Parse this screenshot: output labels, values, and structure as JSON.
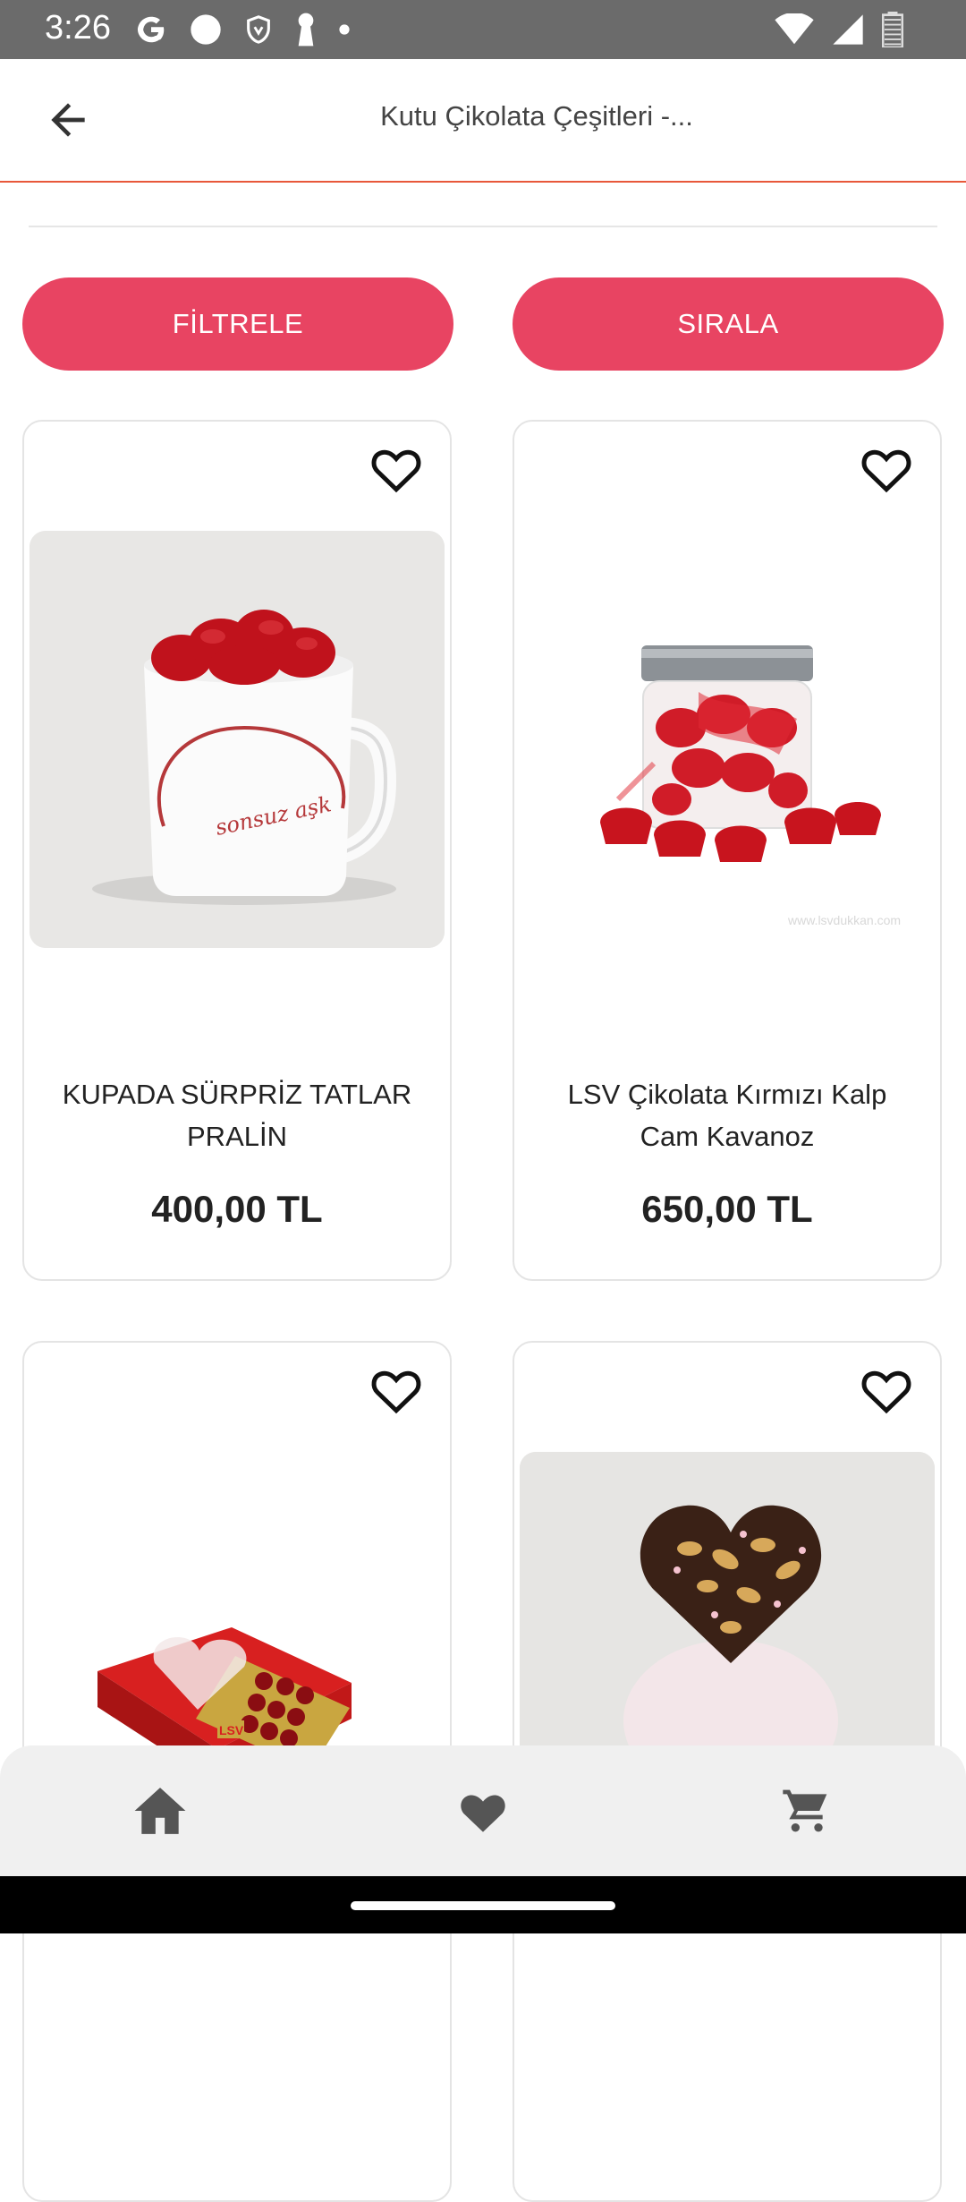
{
  "status_bar": {
    "time": "3:26",
    "left_icons": [
      "google-icon",
      "circle-icon",
      "shield-icon",
      "keyhole-icon",
      "dot-icon"
    ],
    "right_icons": [
      "wifi-icon",
      "signal-icon",
      "battery-icon"
    ]
  },
  "header": {
    "title": "Kutu Çikolata Çeşitleri -..."
  },
  "actions": {
    "filter_label": "FİLTRELE",
    "sort_label": "SIRALA"
  },
  "products": [
    {
      "name": "KUPADA SÜRPRİZ TATLAR PRALİN",
      "price": "400,00 TL",
      "image": "mug-with-red-chocolates-image",
      "image_caption": "sonsuz aşk"
    },
    {
      "name": "LSV Çikolata Kırmızı Kalp Cam Kavanoz",
      "price": "650,00 TL",
      "image": "jar-with-red-heart-chocolates-image",
      "watermark": "www.lsvdukkan.com"
    },
    {
      "name": "",
      "price": "",
      "image": "red-heart-chocolate-box-image",
      "box_label": "LSV"
    },
    {
      "name": "",
      "price": "",
      "image": "chocolate-heart-with-nuts-image"
    }
  ],
  "bottom_nav": {
    "items": [
      "home-icon",
      "favorites-icon",
      "cart-icon"
    ]
  },
  "colors": {
    "accent": "#e84462",
    "appbar_border": "#e8583a",
    "status_bar": "#6b6b6b"
  }
}
